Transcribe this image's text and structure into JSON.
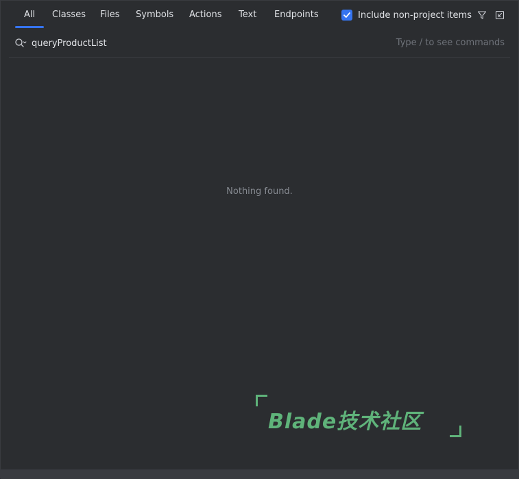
{
  "tabs": [
    {
      "label": "All",
      "active": true
    },
    {
      "label": "Classes"
    },
    {
      "label": "Files"
    },
    {
      "label": "Symbols"
    },
    {
      "label": "Actions"
    },
    {
      "label": "Text"
    },
    {
      "label": "Endpoints"
    }
  ],
  "options": {
    "include_non_project_label": "Include non-project items",
    "include_non_project_checked": true,
    "filter_icon": "filter-icon",
    "open_in_window_icon": "open-in-tool-window-icon"
  },
  "search": {
    "icon": "search-icon",
    "value": "queryProductList",
    "hint": "Type / to see commands"
  },
  "results": {
    "empty_message": "Nothing found."
  },
  "watermark": {
    "text": "Blade技术社区"
  },
  "colors": {
    "background": "#2b2d30",
    "accent": "#3574f0",
    "watermark": "#5fb37a"
  }
}
